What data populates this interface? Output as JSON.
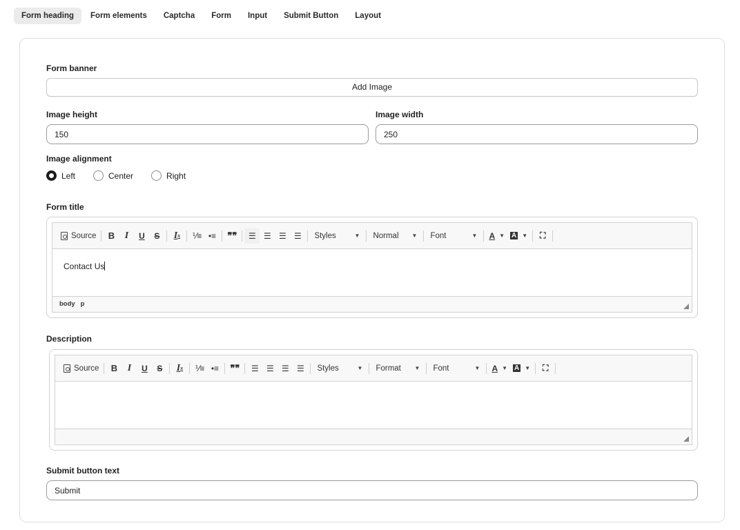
{
  "tabs": [
    "Form heading",
    "Form elements",
    "Captcha",
    "Form",
    "Input",
    "Submit Button",
    "Layout"
  ],
  "form_banner": {
    "label": "Form banner",
    "button": "Add Image"
  },
  "image_height": {
    "label": "Image height",
    "value": "150"
  },
  "image_width": {
    "label": "Image width",
    "value": "250"
  },
  "image_alignment": {
    "label": "Image alignment",
    "options": [
      "Left",
      "Center",
      "Right"
    ],
    "selected": "Left"
  },
  "form_title": {
    "label": "Form title",
    "toolbar": {
      "source": "Source",
      "styles": "Styles",
      "format": "Normal",
      "font": "Font"
    },
    "content": "Contact Us",
    "path": [
      "body",
      "p"
    ]
  },
  "description": {
    "label": "Description",
    "toolbar": {
      "source": "Source",
      "styles": "Styles",
      "format": "Format",
      "font": "Font"
    },
    "content": ""
  },
  "submit_text": {
    "label": "Submit button text",
    "value": "Submit"
  }
}
